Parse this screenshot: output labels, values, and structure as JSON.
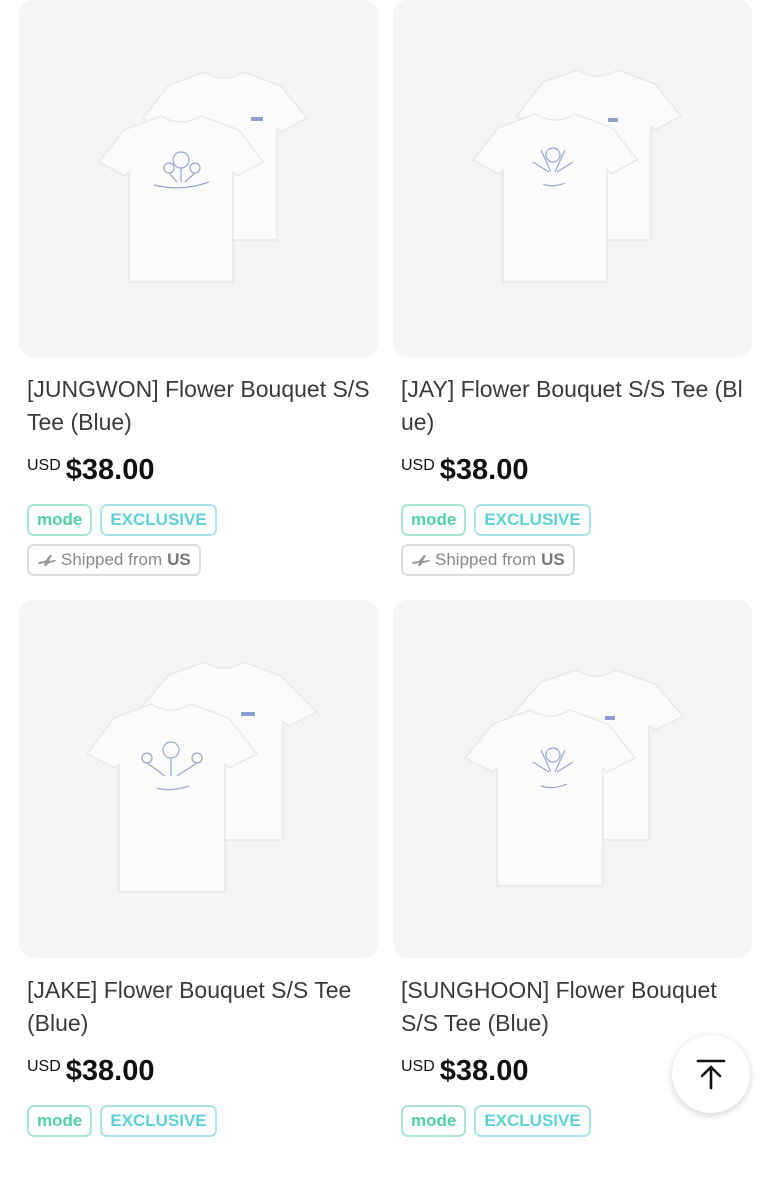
{
  "products": [
    {
      "title": "[JUNGWON] Flower Bouquet S/S Tee (Blue)",
      "currency": "USD",
      "price": "$38.00",
      "badges": [
        "mode",
        "EXCLUSIVE"
      ],
      "shipping": {
        "prefix": "Shipped from",
        "country": "US"
      }
    },
    {
      "title": "[JAY] Flower Bouquet S/S Tee (Blue)",
      "currency": "USD",
      "price": "$38.00",
      "badges": [
        "mode",
        "EXCLUSIVE"
      ],
      "shipping": {
        "prefix": "Shipped from",
        "country": "US"
      }
    },
    {
      "title": "[JAKE] Flower Bouquet S/S Tee (Blue)",
      "currency": "USD",
      "price": "$38.00",
      "badges": [
        "mode",
        "EXCLUSIVE"
      ]
    },
    {
      "title": "[SUNGHOON] Flower Bouquet S/S Tee (Blue)",
      "currency": "USD",
      "price": "$38.00",
      "badges": [
        "mode",
        "EXCLUSIVE"
      ]
    }
  ],
  "icons": {
    "shipping": "airplane-icon",
    "scroll_top": "arrow-up-to-top-icon"
  },
  "colors": {
    "mode_badge": "#4fd1a5",
    "exclusive_badge": "#5cd1d6",
    "thumb_bg": "#f5f5f6",
    "price": "#111111"
  }
}
